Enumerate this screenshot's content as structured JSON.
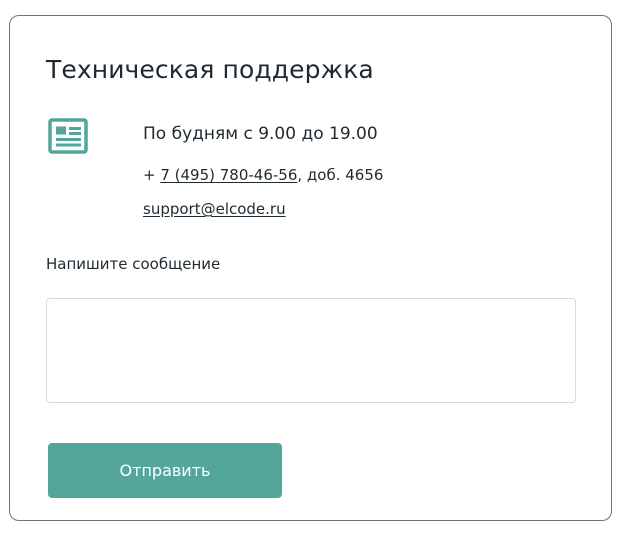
{
  "support": {
    "title": "Техническая поддержка",
    "icon": "newspaper-icon",
    "accent_color": "#54a59a",
    "hours": "По будням с 9.00 до 19.00",
    "phone_prefix": "+ ",
    "phone": "7 (495) 780-46-56",
    "phone_ext": ", доб. 4656",
    "email": "support@elcode.ru"
  },
  "form": {
    "message_label": "Напишите сообщение",
    "message_value": "",
    "submit_label": "Отправить"
  }
}
